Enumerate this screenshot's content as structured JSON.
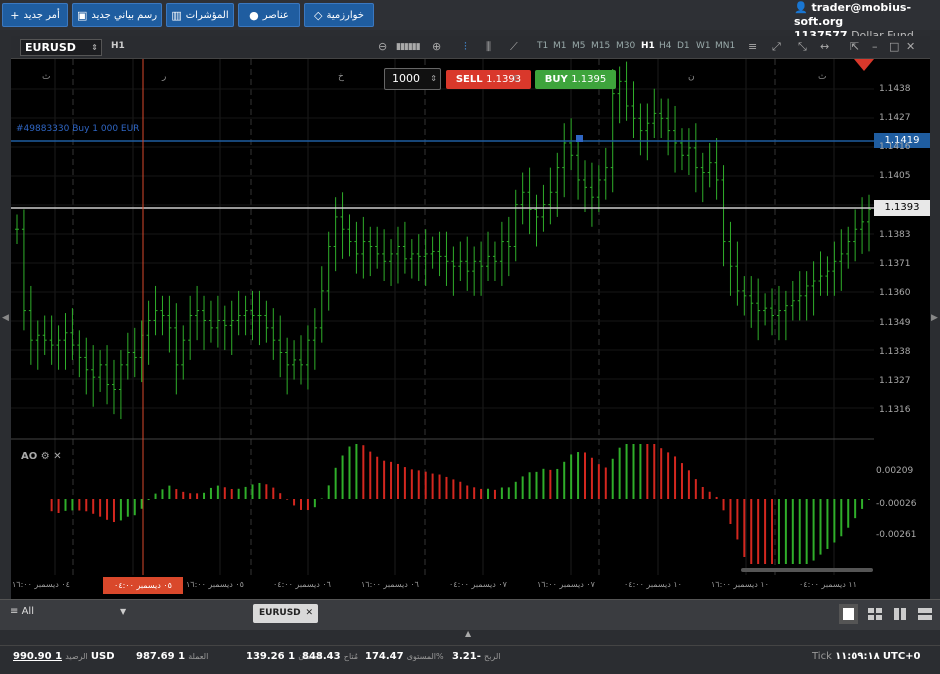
{
  "toolbar": {
    "new_order": "أمر جديد",
    "new_chart": "رسم بياني جديد",
    "indicators": "المؤشرات",
    "elements": "عناصر",
    "algorithm": "خوارزمية"
  },
  "account": {
    "user": "trader@mobius-soft.org",
    "number": "1137577",
    "fund": "Dollar Fund"
  },
  "chart": {
    "symbol": "EURUSD",
    "period": "H1",
    "timeframes": [
      "T1",
      "M1",
      "M5",
      "M15",
      "M30",
      "H1",
      "H4",
      "D1",
      "W1",
      "MN1"
    ],
    "active_tf": "H1",
    "quantity": "1000",
    "sell_label": "SELL",
    "sell_price": "1.1393",
    "buy_label": "BUY",
    "buy_price": "1.1395",
    "order_line": "#49883330 Buy 1 000 EUR",
    "order_price": "1.1419",
    "bid_price": "1.1393",
    "price_ticks": [
      "1.1438",
      "1.1427",
      "1.1416",
      "1.1405",
      "1.1383",
      "1.1371",
      "1.1360",
      "1.1349",
      "1.1338",
      "1.1327",
      "1.1316"
    ],
    "ao_title": "AO",
    "ao_ticks": [
      "0.00209",
      "-0.00026",
      "-0.00261"
    ],
    "day_labels": [
      "ث",
      "ر",
      "خ",
      "ج",
      "ن",
      "ث"
    ],
    "time_labels": [
      "٠٤ ديسمبر ١٦:٠٠",
      "٠٥ ديسمبر ١٦:٠٠",
      "٠٦ ديسمبر ٠٤:٠٠",
      "٠٦ ديسمبر ١٦:٠٠",
      "٠٧ ديسمبر ٠٤:٠٠",
      "٠٧ ديسمبر ١٦:٠٠",
      "١٠ ديسمبر ٠٤:٠٠",
      "١٠ ديسمبر ١٦:٠٠",
      "١١ ديسمبر ٠٤:٠٠"
    ],
    "cursor_time": "٠٥ ديسمبر ٠٤:٠٠"
  },
  "bottom": {
    "filter": "All",
    "tab": "EURUSD"
  },
  "status": {
    "balance_value": "990.90 1",
    "balance_label": "الرصيد",
    "balance_currency": "USD",
    "equity_value": "987.69 1",
    "equity_label": "العملة",
    "margin_value": "139.26 1",
    "margin_label": "الضمان",
    "free_value": "848.43",
    "free_label": "مُتاح",
    "level_value": "174.47",
    "level_label": "المستوى%",
    "profit_label": "الربح",
    "profit_value": "-3.21",
    "tick_label": "Tick",
    "clock": "١١:٥٩:١٨",
    "timezone": "UTC+0"
  },
  "colors": {
    "bull": "#2fae2a",
    "bear": "#d4271f",
    "order_line": "#1f5da0",
    "bid_line": "#cccccc"
  }
}
